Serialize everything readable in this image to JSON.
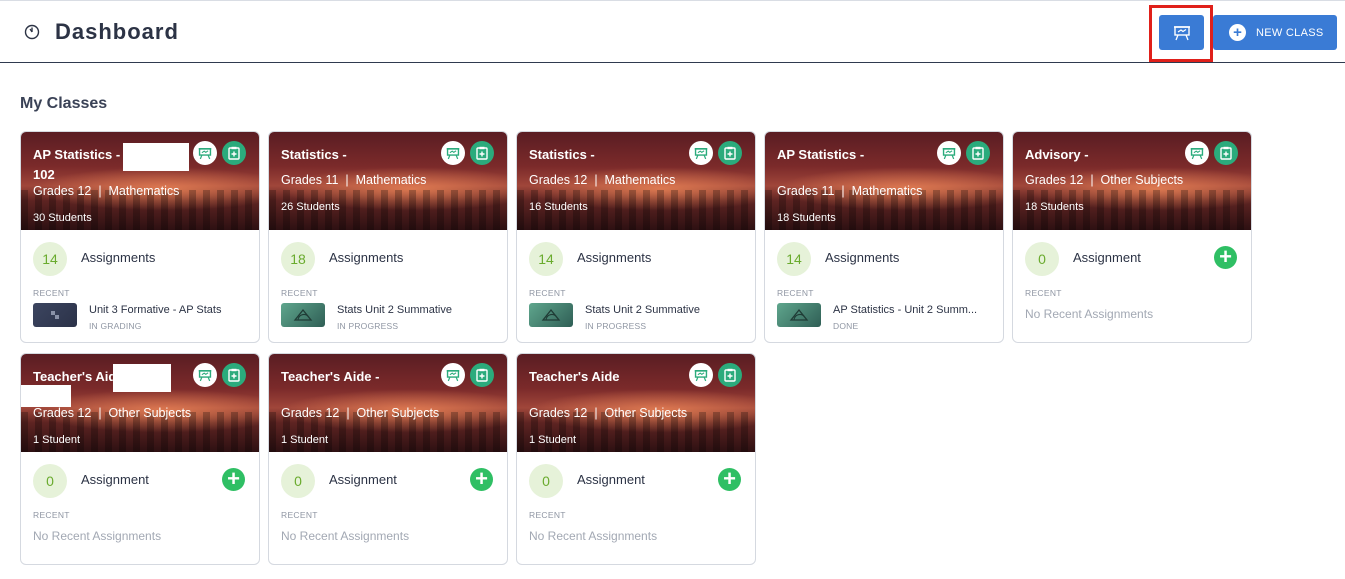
{
  "header": {
    "title": "Dashboard",
    "new_class_label": "NEW CLASS"
  },
  "section_title": "My Classes",
  "colors": {
    "primary": "#3a7bd5",
    "highlight": "#e0201a",
    "add": "#2fbf64",
    "clipboard": "#2bab7c"
  },
  "classes": [
    {
      "title_line1": "AP Statistics -",
      "title_line2": "102",
      "subtitle": "Grades 12  |  Mathematics",
      "students": "30 Students",
      "count": "14",
      "assign_label": "Assignments",
      "recent_label": "RECENT",
      "recent_name": "Unit 3 Formative - AP Stats",
      "recent_status": "IN GRADING",
      "thumb_icon": "grid-icon"
    },
    {
      "title_line1": "Statistics -",
      "subtitle": "Grades 11  |  Mathematics",
      "students": "26 Students",
      "count": "18",
      "assign_label": "Assignments",
      "recent_label": "RECENT",
      "recent_name": "Stats Unit 2 Summative",
      "recent_status": "IN PROGRESS",
      "thumb_icon": "protractor-icon"
    },
    {
      "title_line1": "Statistics -",
      "subtitle": "Grades 12  |  Mathematics",
      "students": "16 Students",
      "count": "14",
      "assign_label": "Assignments",
      "recent_label": "RECENT",
      "recent_name": "Stats Unit 2 Summative",
      "recent_status": "IN PROGRESS",
      "thumb_icon": "protractor-icon"
    },
    {
      "title_line1": "AP Statistics -",
      "subtitle": "Grades 11  |  Mathematics",
      "students": "18 Students",
      "count": "14",
      "assign_label": "Assignments",
      "recent_label": "RECENT",
      "recent_name": "AP Statistics - Unit 2 Summ...",
      "recent_status": "DONE",
      "thumb_icon": "protractor-icon"
    },
    {
      "title_line1": "Advisory -",
      "subtitle": "Grades 12  |  Other Subjects",
      "students": "18 Students",
      "count": "0",
      "assign_label": "Assignment",
      "recent_label": "RECENT",
      "no_recent": "No Recent Assignments"
    },
    {
      "title_line1": "Teacher's Aide -",
      "subtitle": "Grades 12  |  Other Subjects",
      "students": "1 Student",
      "count": "0",
      "assign_label": "Assignment",
      "recent_label": "RECENT",
      "no_recent": "No Recent Assignments"
    },
    {
      "title_line1": "Teacher's Aide -",
      "subtitle": "Grades 12  |  Other Subjects",
      "students": "1 Student",
      "count": "0",
      "assign_label": "Assignment",
      "recent_label": "RECENT",
      "no_recent": "No Recent Assignments"
    },
    {
      "title_line1": "Teacher's Aide",
      "subtitle": "Grades 12  |  Other Subjects",
      "students": "1 Student",
      "count": "0",
      "assign_label": "Assignment",
      "recent_label": "RECENT",
      "no_recent": "No Recent Assignments"
    }
  ]
}
